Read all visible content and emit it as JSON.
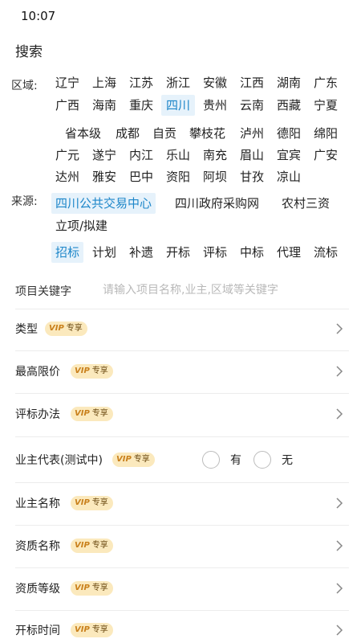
{
  "status_bar": {
    "time": "10:07"
  },
  "page": {
    "title": "搜索"
  },
  "region": {
    "label": "区域:",
    "items": [
      "辽宁",
      "上海",
      "江苏",
      "浙江",
      "安徽",
      "江西",
      "湖南",
      "广东",
      "广西",
      "海南",
      "重庆",
      "四川",
      "贵州",
      "云南",
      "西藏",
      "宁夏",
      "省本级",
      "成都",
      "自贡",
      "攀枝花",
      "泸州",
      "德阳",
      "绵阳",
      "广元",
      "遂宁",
      "内江",
      "乐山",
      "南充",
      "眉山",
      "宜宾",
      "广安",
      "达州",
      "雅安",
      "巴中",
      "资阳",
      "阿坝",
      "甘孜",
      "凉山"
    ],
    "selected": "四川"
  },
  "source": {
    "label": "来源:",
    "items": [
      "四川公共交易中心",
      "四川政府采购网",
      "农村三资",
      "立项/拟建"
    ],
    "selected": "四川公共交易中心"
  },
  "notice_type": {
    "items": [
      "招标",
      "计划",
      "补遗",
      "开标",
      "评标",
      "中标",
      "代理",
      "流标"
    ],
    "selected": "招标"
  },
  "keyword": {
    "label": "项目关键字",
    "placeholder": "请输入项目名称,业主,区域等关键字"
  },
  "vip_badge": {
    "mark": "VIP",
    "text": "专享"
  },
  "form_rows": [
    {
      "label": "类型"
    },
    {
      "label": "最高限价"
    },
    {
      "label": "评标办法"
    },
    {
      "label": "业主代表(测试中)",
      "options": [
        "有",
        "无"
      ]
    },
    {
      "label": "业主名称"
    },
    {
      "label": "资质名称"
    },
    {
      "label": "资质等级"
    },
    {
      "label": "开标时间"
    }
  ],
  "colors": {
    "accent": "#1d86c9",
    "selected_bg": "#e6f2fb",
    "vip_bg": "#fbe9bd",
    "vip_mark": "#c9801c"
  }
}
